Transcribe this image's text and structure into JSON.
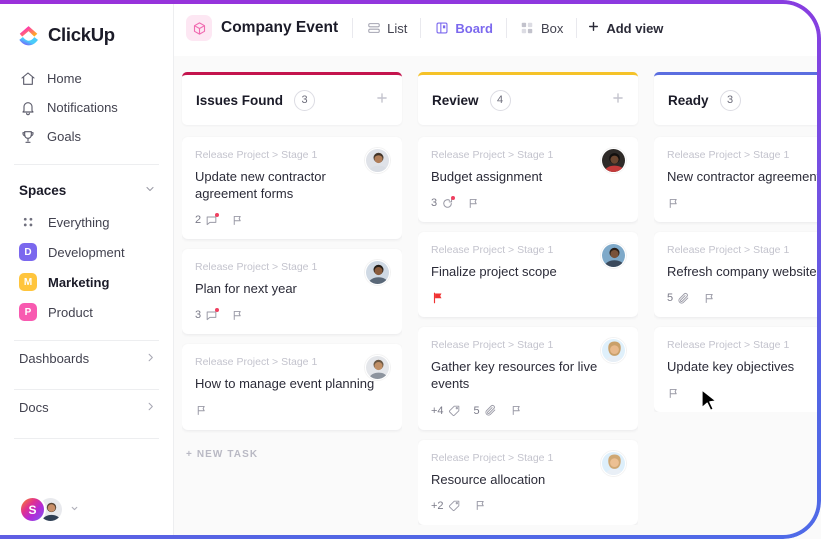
{
  "brand": {
    "name": "ClickUp",
    "logo_icon": "clickup-logo-icon"
  },
  "sidebar": {
    "nav": [
      {
        "label": "Home",
        "icon": "home-icon"
      },
      {
        "label": "Notifications",
        "icon": "bell-icon"
      },
      {
        "label": "Goals",
        "icon": "trophy-icon"
      }
    ],
    "spaces_header": {
      "label": "Spaces",
      "chevron": "chevron-down-icon"
    },
    "everything": {
      "label": "Everything",
      "icon": "grid-dots-icon"
    },
    "spaces": [
      {
        "label": "Development",
        "initial": "D",
        "color": "#7b68ee",
        "active": false
      },
      {
        "label": "Marketing",
        "initial": "M",
        "color": "#ffc53d",
        "active": true
      },
      {
        "label": "Product",
        "initial": "P",
        "color": "#f85ab0",
        "active": false
      }
    ],
    "footer_links": [
      {
        "label": "Dashboards",
        "chevron": "chevron-right-icon"
      },
      {
        "label": "Docs",
        "chevron": "chevron-right-icon"
      }
    ],
    "user": {
      "initial": "S",
      "chevron": "chevron-down-icon"
    }
  },
  "topbar": {
    "project": {
      "name": "Company Event",
      "icon": "cube-icon"
    },
    "views": [
      {
        "label": "List",
        "icon": "list-icon",
        "active": false
      },
      {
        "label": "Board",
        "icon": "board-icon",
        "active": true
      },
      {
        "label": "Box",
        "icon": "box-icon",
        "active": false
      }
    ],
    "add_view": {
      "label": "Add view",
      "icon": "plus-icon"
    }
  },
  "board": {
    "new_task_label": "+ NEW TASK",
    "columns": [
      {
        "title": "Issues Found",
        "count": "3",
        "accent": "#c4144d",
        "add_icon": "plus-icon",
        "show_new_task": true,
        "cards": [
          {
            "breadcrumb": "Release Project > Stage 1",
            "title": "Update new contractor agreement forms",
            "avatar": "avatar-man-1",
            "meta": [
              {
                "icon": "comment-icon",
                "count": "2",
                "dot": true
              },
              {
                "icon": "flag-icon",
                "count": "",
                "dot": false
              }
            ]
          },
          {
            "breadcrumb": "Release Project > Stage 1",
            "title": "Plan for next year",
            "avatar": "avatar-man-2",
            "meta": [
              {
                "icon": "comment-icon",
                "count": "3",
                "dot": true
              },
              {
                "icon": "flag-icon",
                "count": "",
                "dot": false
              }
            ]
          },
          {
            "breadcrumb": "Release Project > Stage 1",
            "title": "How to manage event planning",
            "avatar": "avatar-man-3",
            "meta": [
              {
                "icon": "flag-icon",
                "count": "",
                "dot": false
              }
            ]
          }
        ]
      },
      {
        "title": "Review",
        "count": "4",
        "accent": "#f5c228",
        "add_icon": "plus-icon",
        "show_new_task": false,
        "cards": [
          {
            "breadcrumb": "Release Project > Stage 1",
            "title": "Budget assignment",
            "avatar": "avatar-woman-1",
            "meta": [
              {
                "icon": "recurring-icon",
                "count": "3",
                "dot": true
              },
              {
                "icon": "flag-icon",
                "count": "",
                "dot": false
              }
            ]
          },
          {
            "breadcrumb": "Release Project > Stage 1",
            "title": "Finalize project scope",
            "avatar": "avatar-man-4",
            "meta": [
              {
                "icon": "flag-filled-icon",
                "count": "",
                "dot": false
              }
            ]
          },
          {
            "breadcrumb": "Release Project > Stage 1",
            "title": "Gather key resources for live events",
            "avatar": "avatar-woman-2",
            "meta": [
              {
                "icon": "tag-icon",
                "count": "+4",
                "dot": false
              },
              {
                "icon": "paperclip-icon",
                "count": "5",
                "dot": false
              },
              {
                "icon": "flag-icon",
                "count": "",
                "dot": false
              }
            ]
          },
          {
            "breadcrumb": "Release Project > Stage 1",
            "title": "Resource allocation",
            "avatar": "avatar-woman-3",
            "meta": [
              {
                "icon": "tag-icon",
                "count": "+2",
                "dot": false
              },
              {
                "icon": "flag-icon",
                "count": "",
                "dot": false
              }
            ]
          }
        ]
      },
      {
        "title": "Ready",
        "count": "3",
        "accent": "#5b6ee0",
        "add_icon": "plus-icon",
        "show_new_task": false,
        "cards": [
          {
            "breadcrumb": "Release Project > Stage 1",
            "title": "New contractor agreement",
            "avatar": "",
            "meta": [
              {
                "icon": "flag-icon",
                "count": "",
                "dot": false
              }
            ]
          },
          {
            "breadcrumb": "Release Project > Stage 1",
            "title": "Refresh company website",
            "avatar": "",
            "meta": [
              {
                "icon": "paperclip-icon",
                "count": "5",
                "dot": false
              },
              {
                "icon": "flag-icon",
                "count": "",
                "dot": false
              }
            ]
          },
          {
            "breadcrumb": "Release Project > Stage 1",
            "title": "Update key objectives",
            "avatar": "",
            "meta": [
              {
                "icon": "flag-icon",
                "count": "",
                "dot": false
              }
            ]
          }
        ]
      }
    ]
  },
  "cursor": {
    "icon": "mouse-pointer-icon"
  }
}
